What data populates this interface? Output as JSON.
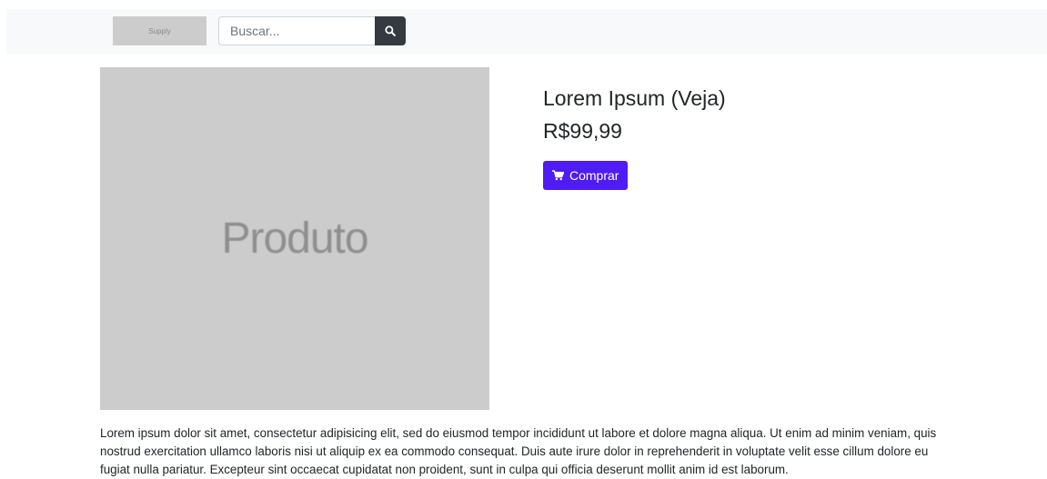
{
  "navbar": {
    "logo_text": "Supply",
    "search": {
      "placeholder": "Buscar...",
      "value": ""
    },
    "search_button_icon": "search-icon"
  },
  "product": {
    "image_text": "Produto",
    "title": "Lorem Ipsum (Veja)",
    "price": "R$99,99",
    "buy_button": {
      "label": "Comprar",
      "icon": "cart-icon",
      "color": "#4f1cf5"
    },
    "description": "Lorem ipsum dolor sit amet, consectetur adipisicing elit, sed do eiusmod tempor incididunt ut labore et dolore magna aliqua. Ut enim ad minim veniam, quis nostrud exercitation ullamco laboris nisi ut aliquip ex ea commodo consequat. Duis aute irure dolor in reprehenderit in voluptate velit esse cillum dolore eu fugiat nulla pariatur. Excepteur sint occaecat cupidatat non proident, sunt in culpa qui officia deserunt mollit anim id est laborum."
  }
}
